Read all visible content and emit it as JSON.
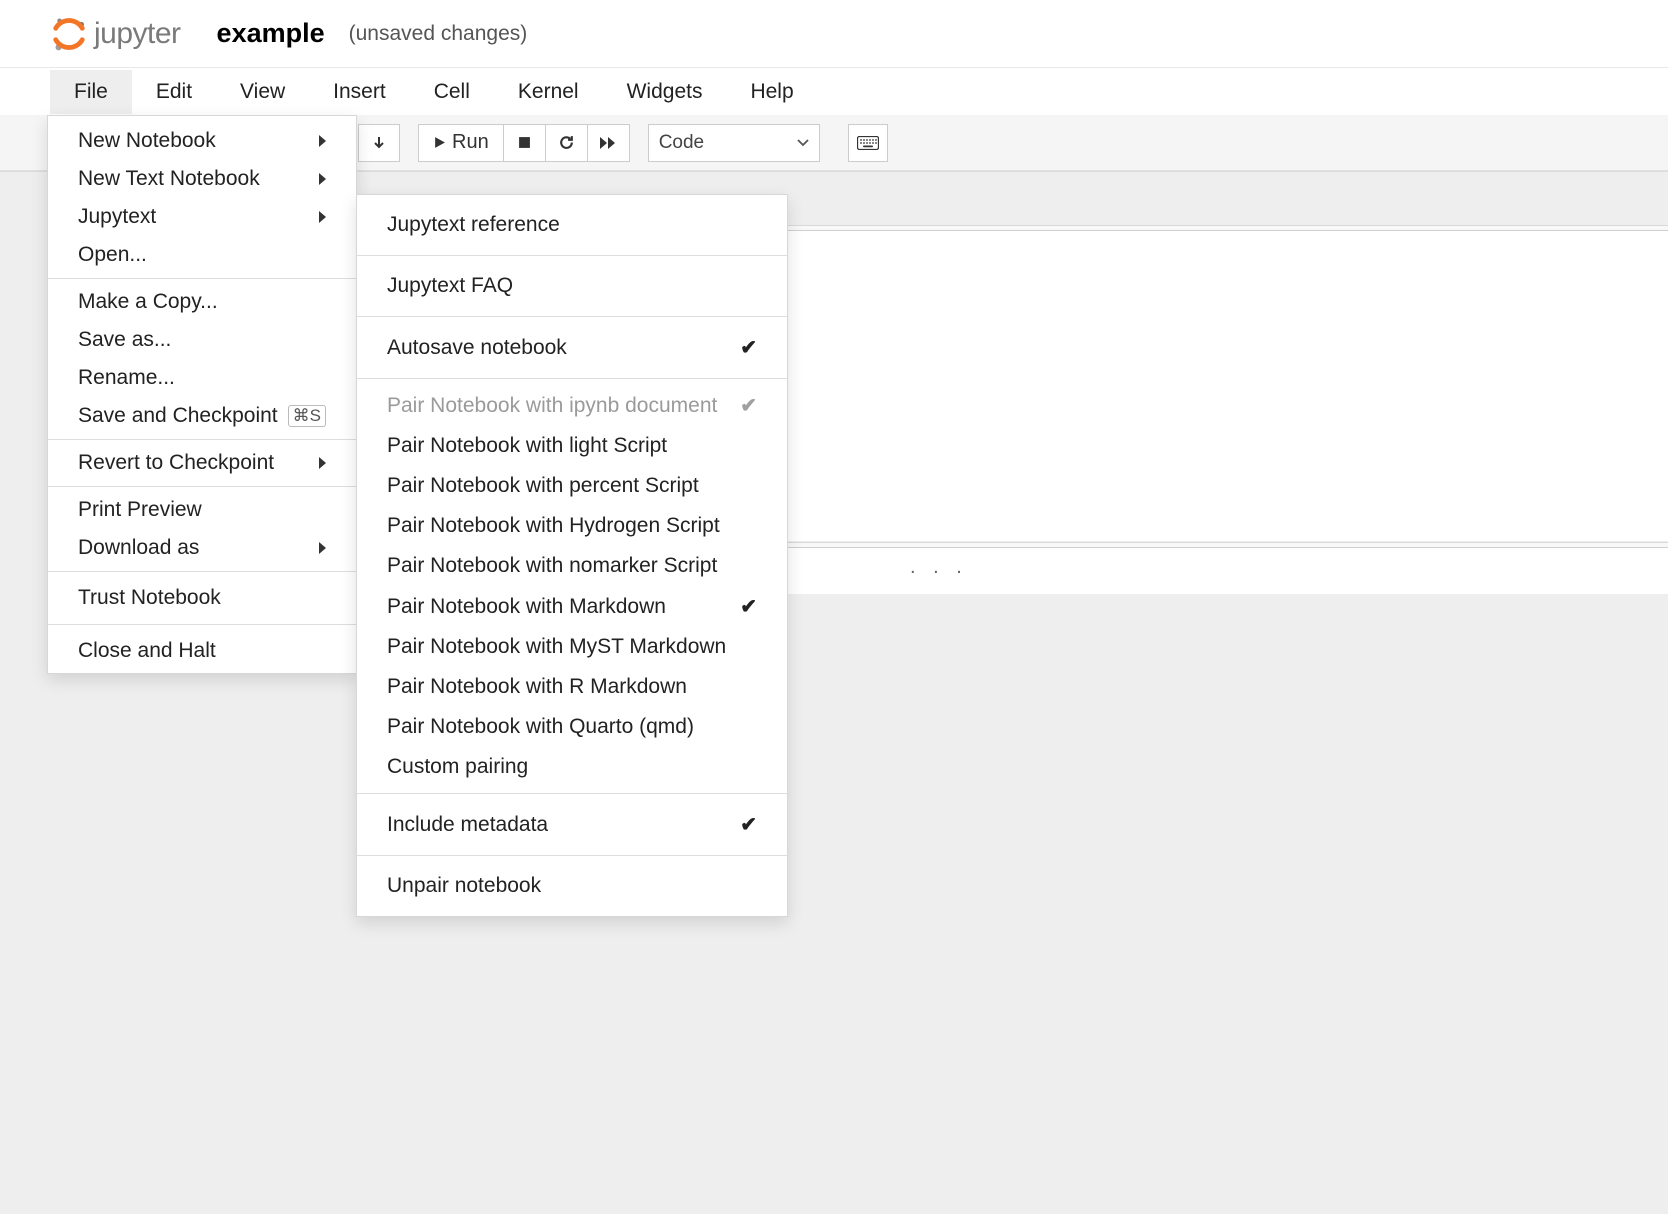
{
  "header": {
    "logo_text": "jupyter",
    "title": "example",
    "status": "(unsaved changes)"
  },
  "menubar": {
    "items": [
      "File",
      "Edit",
      "View",
      "Insert",
      "Cell",
      "Kernel",
      "Widgets",
      "Help"
    ],
    "active": "File"
  },
  "toolbar": {
    "run_label": "Run",
    "celltype": "Code"
  },
  "file_menu": {
    "items": [
      {
        "label": "New Notebook",
        "submenu": true
      },
      {
        "label": "New Text Notebook",
        "submenu": true
      },
      {
        "label": "Jupytext",
        "submenu": true
      },
      {
        "label": "Open..."
      }
    ],
    "group2": [
      {
        "label": "Make a Copy..."
      },
      {
        "label": "Save as..."
      },
      {
        "label": "Rename..."
      },
      {
        "label": "Save and Checkpoint",
        "kbd": "⌘S"
      }
    ],
    "group3": [
      {
        "label": "Revert to Checkpoint",
        "submenu": true
      }
    ],
    "group4": [
      {
        "label": "Print Preview"
      },
      {
        "label": "Download as",
        "submenu": true
      }
    ],
    "group5": [
      {
        "label": "Trust Notebook"
      }
    ],
    "group6": [
      {
        "label": "Close and Halt"
      }
    ]
  },
  "jupytext_menu": {
    "top": [
      {
        "label": "Jupytext reference"
      },
      {
        "label": "Jupytext FAQ"
      },
      {
        "label": "Autosave notebook",
        "checked": true
      }
    ],
    "pairs": [
      {
        "label": "Pair Notebook with ipynb document",
        "checked": true,
        "disabled": true
      },
      {
        "label": "Pair Notebook with light Script"
      },
      {
        "label": "Pair Notebook with percent Script"
      },
      {
        "label": "Pair Notebook with Hydrogen Script"
      },
      {
        "label": "Pair Notebook with nomarker Script"
      },
      {
        "label": "Pair Notebook with Markdown",
        "checked": true
      },
      {
        "label": "Pair Notebook with MyST Markdown"
      },
      {
        "label": "Pair Notebook with R Markdown"
      },
      {
        "label": "Pair Notebook with Quarto (qmd)"
      },
      {
        "label": "Custom pairing"
      }
    ],
    "meta": [
      {
        "label": "Include metadata",
        "checked": true
      }
    ],
    "bottom": [
      {
        "label": "Unpair notebook"
      }
    ]
  },
  "ellipsis": ". . ."
}
